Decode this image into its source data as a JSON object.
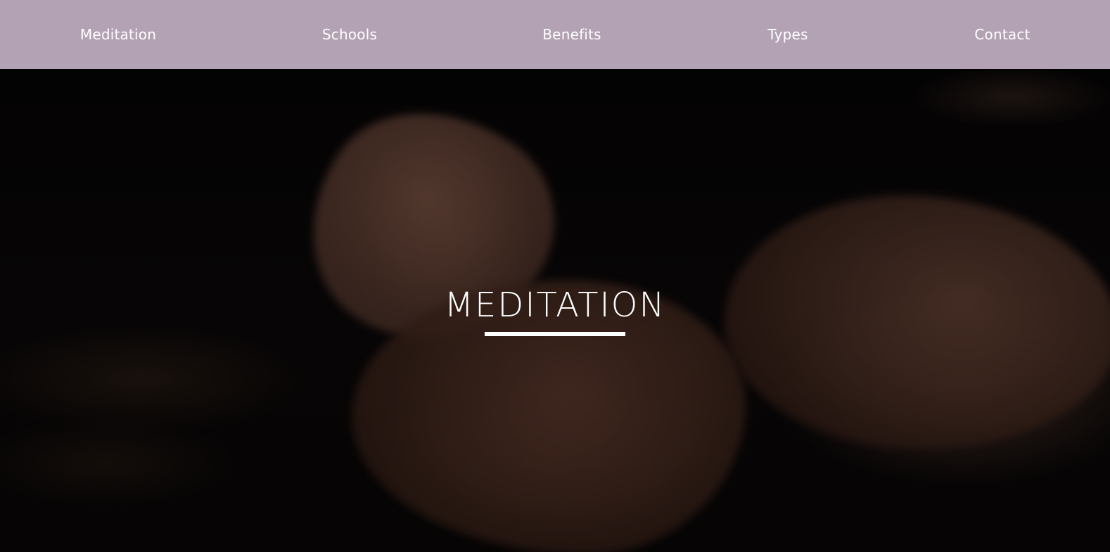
{
  "nav": {
    "items": [
      {
        "label": "Meditation"
      },
      {
        "label": "Schools"
      },
      {
        "label": "Benefits"
      },
      {
        "label": "Types"
      },
      {
        "label": "Contact"
      }
    ],
    "background_color": "#b3a2b4",
    "text_color": "#ffffff"
  },
  "hero": {
    "title": "MEDITATION",
    "title_color": "#ffffff"
  }
}
